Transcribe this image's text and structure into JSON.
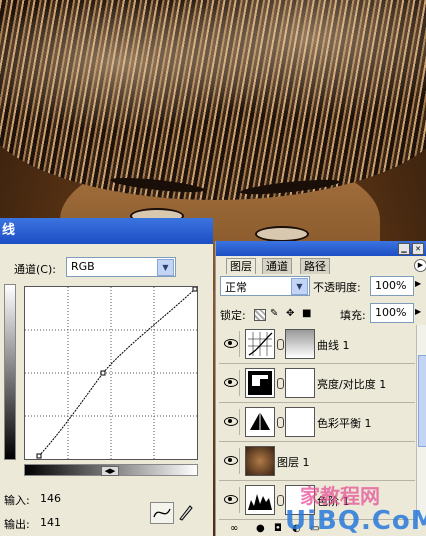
{
  "curves": {
    "title": "线",
    "channel_label": "通道(C):",
    "channel_value": "RGB",
    "input_label": "输入:",
    "input_value": "146",
    "output_label": "输出:",
    "output_value": "141"
  },
  "layers": {
    "tabs": [
      "图层",
      "通道",
      "路径"
    ],
    "blend_mode": "正常",
    "opacity_label": "不透明度:",
    "opacity_value": "100%",
    "lock_label": "锁定:",
    "fill_label": "填充:",
    "fill_value": "100%",
    "items": [
      {
        "name": "曲线 1"
      },
      {
        "name": "亮度/对比度 1"
      },
      {
        "name": "色彩平衡 1"
      },
      {
        "name": "图层 1"
      },
      {
        "name": "色阶 1"
      }
    ]
  },
  "watermark": {
    "text1": "家教程网",
    "text2": "UiBQ.CoM"
  },
  "colors": {
    "title_blue": "#245edb",
    "panel_bg": "#ece9d8"
  }
}
